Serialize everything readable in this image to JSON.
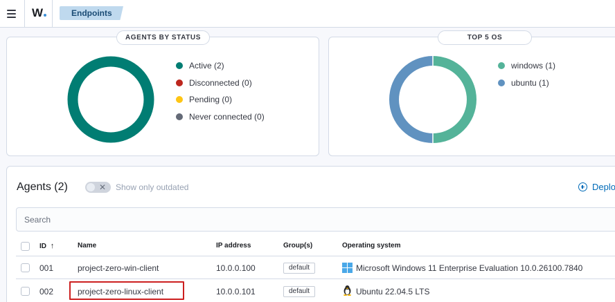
{
  "header": {
    "logo_text": "W",
    "breadcrumb": "Endpoints"
  },
  "status_panel": {
    "title": "AGENTS BY STATUS",
    "legend": [
      {
        "label": "Active (2)",
        "color": "#017d73"
      },
      {
        "label": "Disconnected (0)",
        "color": "#bd271e"
      },
      {
        "label": "Pending (0)",
        "color": "#fec514"
      },
      {
        "label": "Never connected (0)",
        "color": "#646a77"
      }
    ],
    "donut": {
      "active": 2,
      "disconnected": 0,
      "pending": 0,
      "never_connected": 0
    }
  },
  "os_panel": {
    "title": "TOP 5 OS",
    "legend": [
      {
        "label": "windows (1)",
        "color": "#54b399"
      },
      {
        "label": "ubuntu (1)",
        "color": "#6092c0"
      }
    ],
    "donut": {
      "windows": 1,
      "ubuntu": 1
    }
  },
  "agents": {
    "title": "Agents (2)",
    "toggle_label": "Show only outdated",
    "toggle_icon": "x-icon",
    "deploy_label": "Deplo",
    "search_placeholder": "Search",
    "columns": [
      "ID",
      "Name",
      "IP address",
      "Group(s)",
      "Operating system"
    ],
    "sort_icon": "↑",
    "rows": [
      {
        "id": "001",
        "name": "project-zero-win-client",
        "ip": "10.0.0.100",
        "group": "default",
        "os": "Microsoft Windows 11 Enterprise Evaluation 10.0.26100.7840",
        "os_icon": "windows-icon"
      },
      {
        "id": "002",
        "name": "project-zero-linux-client",
        "ip": "10.0.0.101",
        "group": "default",
        "os": "Ubuntu 22.04.5 LTS",
        "os_icon": "linux-tux-icon"
      }
    ]
  }
}
